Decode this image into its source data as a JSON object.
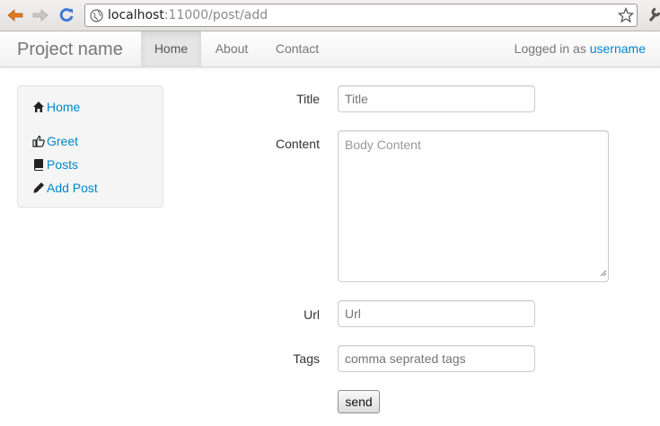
{
  "browser": {
    "url_host": "localhost",
    "url_path": ":11000/post/add",
    "icons": [
      "back-arrow-icon",
      "forward-arrow-icon",
      "reload-icon",
      "globe-icon",
      "bookmark-star-icon",
      "wrench-icon"
    ],
    "colors": {
      "back_arrow": "#e07a1f",
      "reload": "#3a7bd5"
    }
  },
  "navbar": {
    "brand": "Project name",
    "items": [
      {
        "label": "Home",
        "active": true
      },
      {
        "label": "About",
        "active": false
      },
      {
        "label": "Contact",
        "active": false
      }
    ],
    "logged_in_prefix": "Logged in as",
    "username": "username"
  },
  "sidebar": {
    "items": [
      {
        "label": "Home",
        "icon": "home-icon"
      },
      {
        "label": "Greet",
        "icon": "thumbs-up-icon"
      },
      {
        "label": "Posts",
        "icon": "book-icon"
      },
      {
        "label": "Add Post",
        "icon": "pencil-icon"
      }
    ]
  },
  "form": {
    "title": {
      "label": "Title",
      "placeholder": "Title",
      "value": ""
    },
    "content": {
      "label": "Content",
      "placeholder": "Body Content",
      "value": ""
    },
    "url": {
      "label": "Url",
      "placeholder": "Url",
      "value": ""
    },
    "tags": {
      "label": "Tags",
      "placeholder": "comma seprated tags",
      "value": ""
    },
    "submit_label": "send"
  },
  "colors": {
    "link": "#0088cc",
    "text": "#333333",
    "muted": "#777777"
  }
}
